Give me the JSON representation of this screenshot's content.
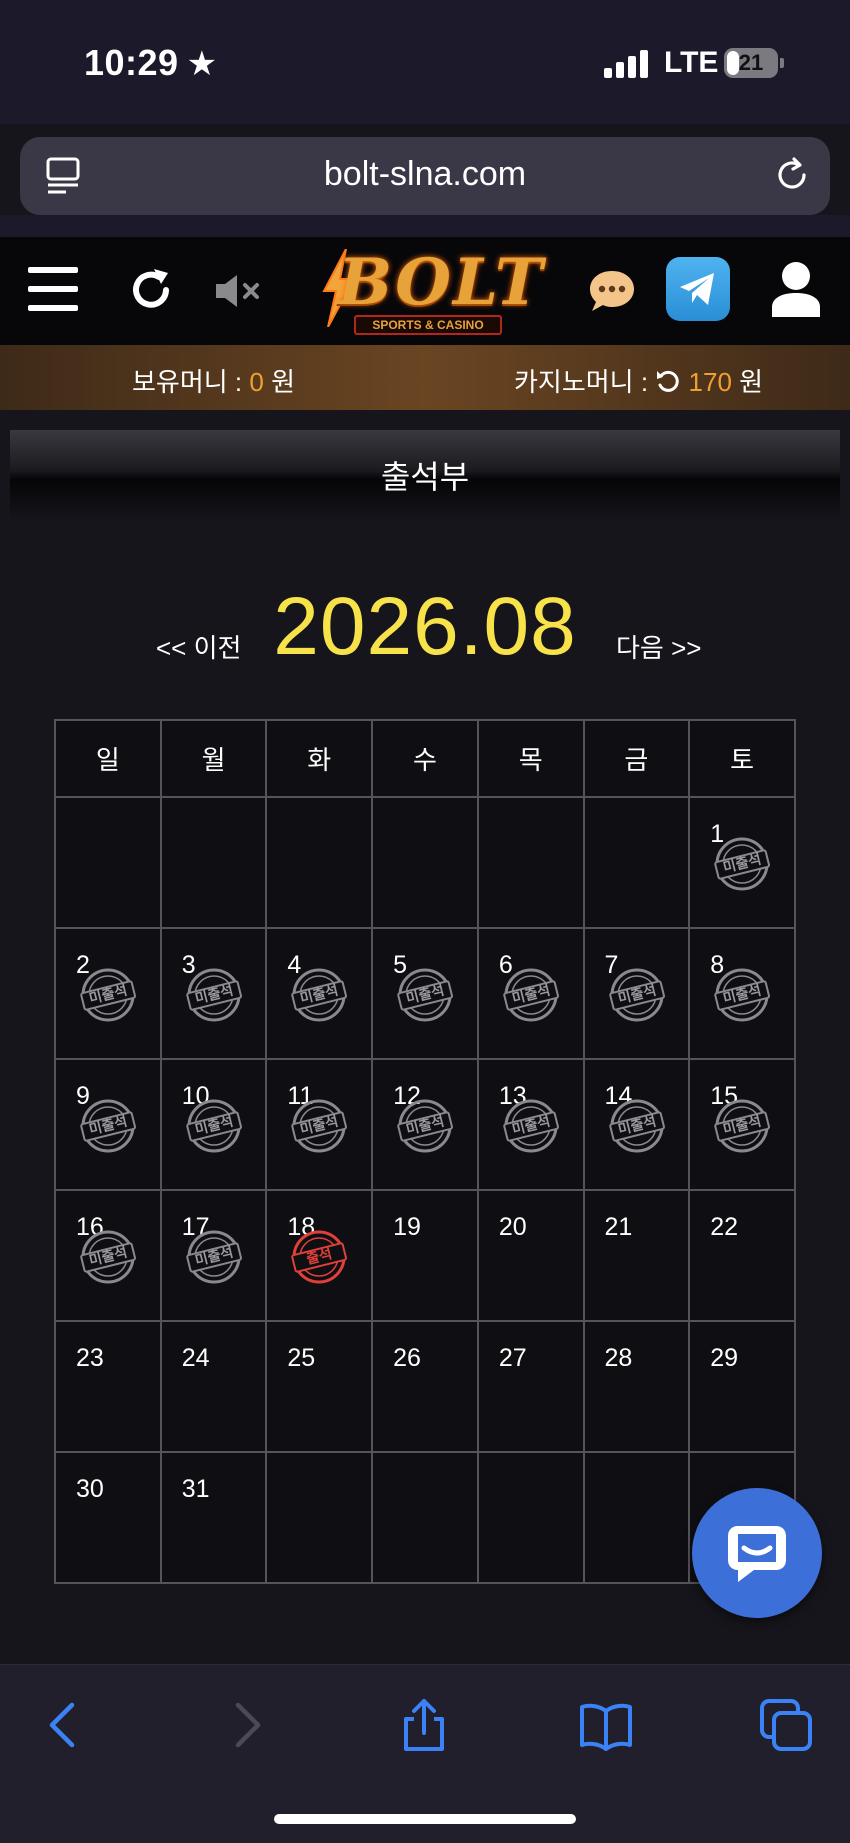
{
  "status_bar": {
    "time": "10:29",
    "network": "LTE",
    "battery": "21"
  },
  "browser": {
    "url": "bolt-slna.com"
  },
  "header": {
    "logo_text": "BOLT",
    "logo_subtitle": "SPORTS & CASINO",
    "icons": [
      "menu-icon",
      "refresh-icon",
      "mute-icon",
      "chat-icon",
      "telegram-icon",
      "user-icon"
    ]
  },
  "money_bar": {
    "balance_label": "보유머니 :",
    "balance_value": "0",
    "balance_unit": "원",
    "casino_label": "카지노머니 :",
    "casino_value": "170",
    "casino_unit": "원"
  },
  "page": {
    "title": "출석부"
  },
  "calendar": {
    "prev_label": "<< 이전",
    "month": "2026.08",
    "next_label": "다음 >>",
    "weekdays": [
      "일",
      "월",
      "화",
      "수",
      "목",
      "금",
      "토"
    ],
    "missed_stamp": "미출석",
    "attended_stamp": "출석",
    "weeks": [
      [
        null,
        null,
        null,
        null,
        null,
        null,
        {
          "day": "1",
          "status": "missed"
        }
      ],
      [
        {
          "day": "2",
          "status": "missed"
        },
        {
          "day": "3",
          "status": "missed"
        },
        {
          "day": "4",
          "status": "missed"
        },
        {
          "day": "5",
          "status": "missed"
        },
        {
          "day": "6",
          "status": "missed"
        },
        {
          "day": "7",
          "status": "missed"
        },
        {
          "day": "8",
          "status": "missed"
        }
      ],
      [
        {
          "day": "9",
          "status": "missed"
        },
        {
          "day": "10",
          "status": "missed"
        },
        {
          "day": "11",
          "status": "missed"
        },
        {
          "day": "12",
          "status": "missed"
        },
        {
          "day": "13",
          "status": "missed"
        },
        {
          "day": "14",
          "status": "missed"
        },
        {
          "day": "15",
          "status": "missed"
        }
      ],
      [
        {
          "day": "16",
          "status": "missed"
        },
        {
          "day": "17",
          "status": "missed"
        },
        {
          "day": "18",
          "status": "attended"
        },
        {
          "day": "19",
          "status": ""
        },
        {
          "day": "20",
          "status": ""
        },
        {
          "day": "21",
          "status": ""
        },
        {
          "day": "22",
          "status": ""
        }
      ],
      [
        {
          "day": "23",
          "status": ""
        },
        {
          "day": "24",
          "status": ""
        },
        {
          "day": "25",
          "status": ""
        },
        {
          "day": "26",
          "status": ""
        },
        {
          "day": "27",
          "status": ""
        },
        {
          "day": "28",
          "status": ""
        },
        {
          "day": "29",
          "status": ""
        }
      ],
      [
        {
          "day": "30",
          "status": ""
        },
        {
          "day": "31",
          "status": ""
        },
        null,
        null,
        null,
        null,
        null
      ]
    ]
  },
  "colors": {
    "accent_yellow": "#f7e24a",
    "money_orange": "#f0a030",
    "chat_blue": "#3d6fd8",
    "attended_red": "#e0403a"
  }
}
